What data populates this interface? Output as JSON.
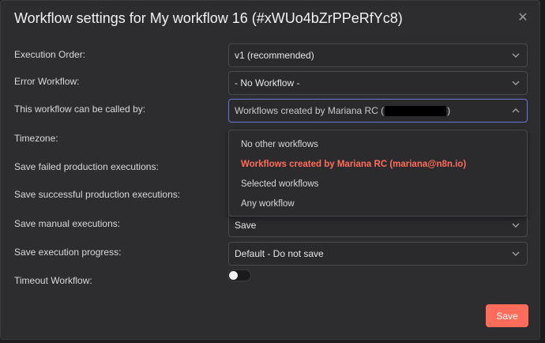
{
  "dialog": {
    "title": "Workflow settings for My workflow 16 (#xWUo4bZrPPeRfYc8)",
    "close_icon": "close-icon"
  },
  "fields": {
    "execution_order": {
      "label": "Execution Order:",
      "value": "v1 (recommended)"
    },
    "error_workflow": {
      "label": "Error Workflow:",
      "value": "- No Workflow -"
    },
    "callable_by": {
      "label": "This workflow can be called by:",
      "value_prefix": "Workflows created by Mariana RC (",
      "value_suffix": ")"
    },
    "timezone": {
      "label": "Timezone:"
    },
    "save_failed": {
      "label": "Save failed production executions:"
    },
    "save_successful": {
      "label": "Save successful production executions:"
    },
    "save_manual": {
      "label": "Save manual executions:",
      "value": "Save"
    },
    "save_progress": {
      "label": "Save execution progress:",
      "value": "Default - Do not save"
    },
    "timeout": {
      "label": "Timeout Workflow:",
      "enabled": false
    }
  },
  "dropdown": {
    "options": [
      {
        "label": "No other workflows",
        "selected": false
      },
      {
        "label": "Workflows created by Mariana RC (mariana@n8n.io)",
        "selected": true
      },
      {
        "label": "Selected workflows",
        "selected": false
      },
      {
        "label": "Any workflow",
        "selected": false
      }
    ]
  },
  "footer": {
    "save_label": "Save"
  },
  "colors": {
    "accent": "#ff6d5a",
    "focus_border": "#6b74d6",
    "background": "#2d2d30"
  }
}
